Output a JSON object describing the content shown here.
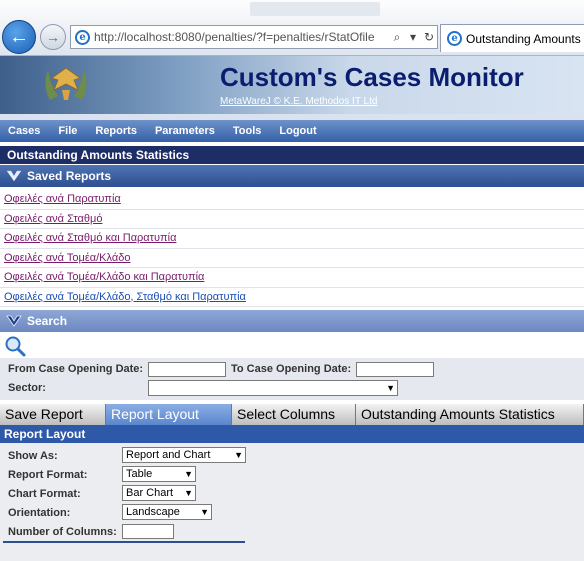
{
  "browser": {
    "url_text": "http://localhost:8080/penalties/?f=penalties/rStatOfile",
    "tab_title": "Outstanding Amounts",
    "search_glyph": "⌕",
    "refresh_glyph": "↻"
  },
  "header": {
    "title": "Custom's Cases Monitor",
    "subtitle": "MetaWareJ © K.E. Methodos IT Ltd"
  },
  "menu": [
    "Cases",
    "File",
    "Reports",
    "Parameters",
    "Tools",
    "Logout"
  ],
  "page_title": "Outstanding Amounts Statistics",
  "saved_reports": {
    "heading": "Saved Reports",
    "items": [
      "Οφειλές ανά Παρατυπία",
      "Οφειλές ανά Σταθμό",
      "Οφειλές ανά Σταθμό και Παρατυπία",
      "Οφειλές ανά Τομέα/Κλάδο",
      "Οφειλές ανά Τομέα/Κλάδο και Παρατυπία",
      "Οφειλές ανά Τομέα/Κλάδο, Σταθμό και Παρατυπία"
    ]
  },
  "search": {
    "heading": "Search",
    "from_label": "From Case Opening Date:",
    "from_value": "",
    "to_label": "To Case Opening Date:",
    "to_value": "",
    "sector_label": "Sector:",
    "sector_value": ""
  },
  "tabs": [
    {
      "label": "Save Report",
      "active": false
    },
    {
      "label": "Report Layout",
      "active": true
    },
    {
      "label": "Select Columns",
      "active": false
    },
    {
      "label": "Outstanding Amounts Statistics",
      "active": false
    }
  ],
  "layout": {
    "heading": "Report Layout",
    "show_as_label": "Show As:",
    "show_as_value": "Report and Chart",
    "report_format_label": "Report Format:",
    "report_format_value": "Table",
    "chart_format_label": "Chart Format:",
    "chart_format_value": "Bar Chart",
    "orientation_label": "Orientation:",
    "orientation_value": "Landscape",
    "columns_label": "Number of Columns:",
    "columns_value": ""
  },
  "colors": {
    "title_bar": "#1d2d66",
    "section_bar": "#2d4f91",
    "active_tab": "#5b86cf",
    "visited_link": "#7a1a6b",
    "link": "#1a4fb3"
  }
}
